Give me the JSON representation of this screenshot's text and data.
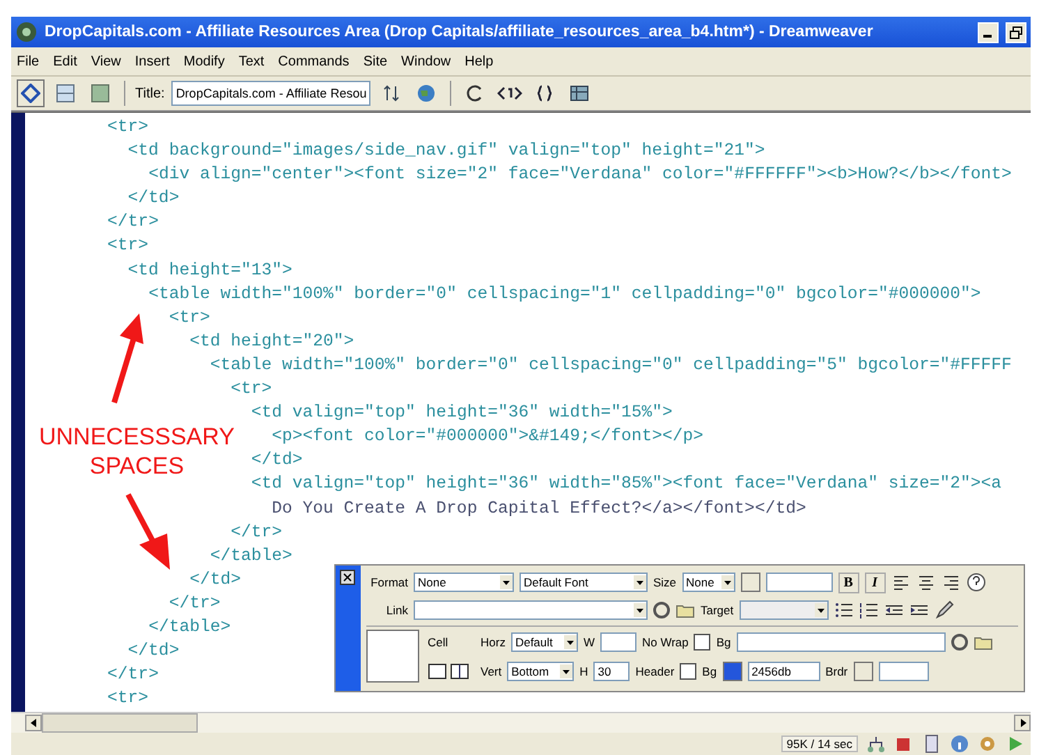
{
  "window": {
    "title": "DropCapitals.com - Affiliate Resources Area (Drop Capitals/affiliate_resources_area_b4.htm*) - Dreamweaver"
  },
  "menu": [
    "File",
    "Edit",
    "View",
    "Insert",
    "Modify",
    "Text",
    "Commands",
    "Site",
    "Window",
    "Help"
  ],
  "toolbar": {
    "title_label": "Title:",
    "title_value": "DropCapitals.com - Affiliate Resou"
  },
  "code_lines": [
    {
      "kind": "tag",
      "text": "        <tr>"
    },
    {
      "kind": "tag",
      "text": "          <td background=\"images/side_nav.gif\" valign=\"top\" height=\"21\">"
    },
    {
      "kind": "tag",
      "text": "            <div align=\"center\"><font size=\"2\" face=\"Verdana\" color=\"#FFFFFF\"><b>How?</b></font>"
    },
    {
      "kind": "tag",
      "text": "          </td>"
    },
    {
      "kind": "tag",
      "text": "        </tr>"
    },
    {
      "kind": "tag",
      "text": "        <tr>"
    },
    {
      "kind": "tag",
      "text": "          <td height=\"13\">"
    },
    {
      "kind": "tag",
      "text": "            <table width=\"100%\" border=\"0\" cellspacing=\"1\" cellpadding=\"0\" bgcolor=\"#000000\">"
    },
    {
      "kind": "tag",
      "text": "              <tr>"
    },
    {
      "kind": "tag",
      "text": "                <td height=\"20\">"
    },
    {
      "kind": "tag",
      "text": "                  <table width=\"100%\" border=\"0\" cellspacing=\"0\" cellpadding=\"5\" bgcolor=\"#FFFFF"
    },
    {
      "kind": "tag",
      "text": "                    <tr>"
    },
    {
      "kind": "tag",
      "text": "                      <td valign=\"top\" height=\"36\" width=\"15%\">"
    },
    {
      "kind": "tag",
      "text": "                        <p><font color=\"#000000\">&#149;</font></p>"
    },
    {
      "kind": "tag",
      "text": "                      </td>"
    },
    {
      "kind": "tag",
      "text": "                      <td valign=\"top\" height=\"36\" width=\"85%\"><font face=\"Verdana\" size=\"2\"><a"
    },
    {
      "kind": "text",
      "text": "                        Do You Create A Drop Capital Effect?</a></font></td>"
    },
    {
      "kind": "tag",
      "text": "                    </tr>"
    },
    {
      "kind": "tag",
      "text": "                  </table>"
    },
    {
      "kind": "tag",
      "text": "                </td>"
    },
    {
      "kind": "tag",
      "text": "              </tr>"
    },
    {
      "kind": "tag",
      "text": "            </table>"
    },
    {
      "kind": "tag",
      "text": "          </td>"
    },
    {
      "kind": "tag",
      "text": "        </tr>"
    },
    {
      "kind": "tag",
      "text": "        <tr>"
    }
  ],
  "annotation": {
    "lines": [
      "UNNECESSSARY",
      "SPACES"
    ]
  },
  "properties": {
    "format_label": "Format",
    "format_value": "None",
    "font_value": "Default Font",
    "size_label": "Size",
    "size_value": "None",
    "bold_label": "B",
    "italic_label": "I",
    "link_label": "Link",
    "target_label": "Target",
    "cell_label": "Cell",
    "horz_label": "Horz",
    "horz_value": "Default",
    "w_label": "W",
    "nowrap_label": "No Wrap",
    "nowrap_checked": false,
    "bg_label": "Bg",
    "vert_label": "Vert",
    "vert_value": "Bottom",
    "h_label": "H",
    "h_value": "30",
    "header_label": "Header",
    "header_checked": false,
    "bgcolor_label": "Bg",
    "bgcolor_value": "2456db",
    "brdr_label": "Brdr"
  },
  "status_bar": {
    "size": "95K / 14 sec"
  }
}
